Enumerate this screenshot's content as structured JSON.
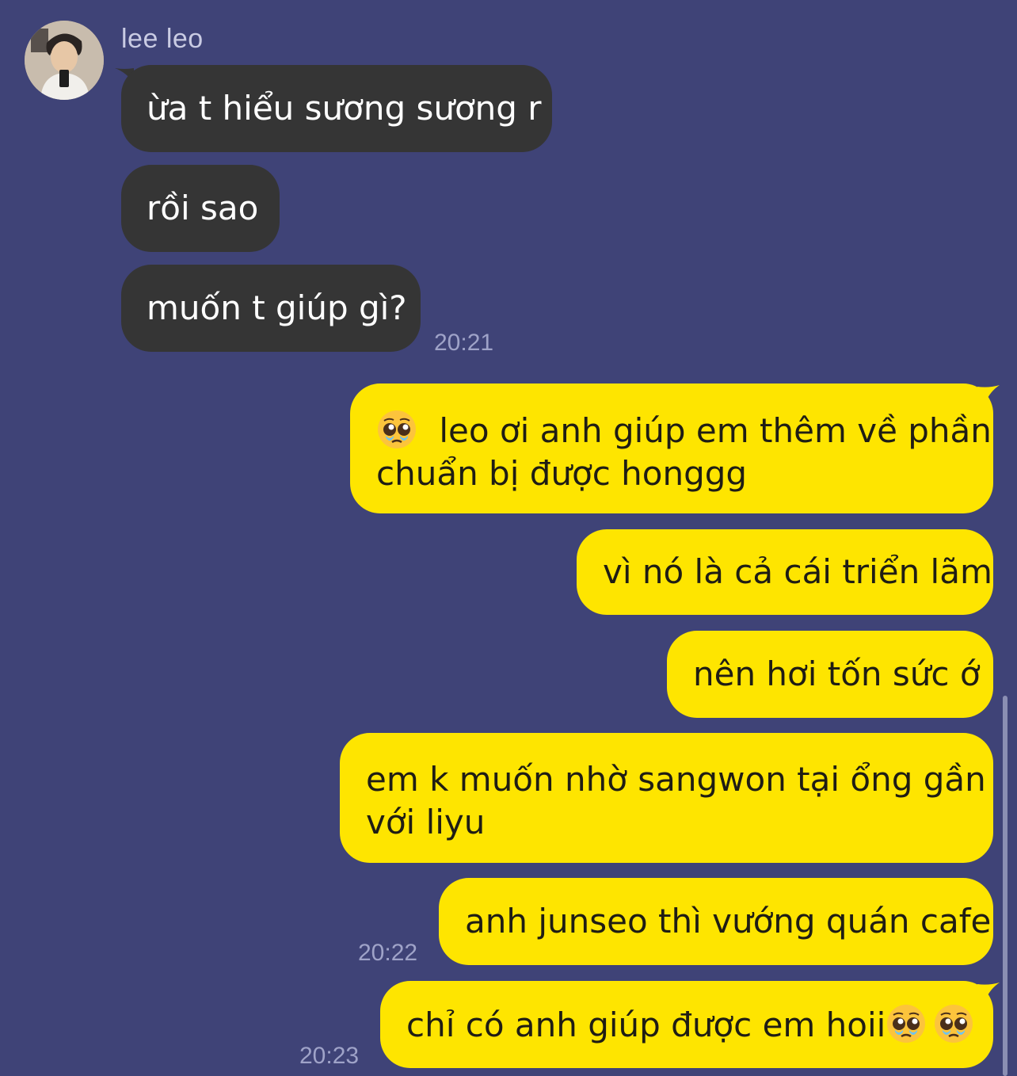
{
  "sender": {
    "name": "lee leo"
  },
  "incoming": [
    {
      "text": "ừa t hiểu sương sương r"
    },
    {
      "text": "rồi sao"
    },
    {
      "text": "muốn t giúp gì?"
    }
  ],
  "incoming_time": "20:21",
  "outgoing": [
    {
      "line1": "leo ơi anh giúp em thêm về phần",
      "line2": "chuẩn bị được honggg",
      "leading_emoji": "pleading-face-emoji"
    },
    {
      "text": "vì nó là cả cái triển lãm"
    },
    {
      "text": "nên hơi tốn sức ớ"
    },
    {
      "line1": "em k muốn nhờ sangwon tại ổng gần",
      "line2": "với liyu"
    },
    {
      "text": "anh junseo thì vướng quán cafe"
    },
    {
      "text": "chỉ có anh giúp được em hoii",
      "trailing_emoji": [
        "pleading-face-emoji",
        "pleading-face-emoji"
      ]
    }
  ],
  "outgoing_times": {
    "t1": "20:22",
    "t2": "20:23"
  },
  "colors": {
    "background": "#3f4377",
    "incoming_bubble": "#353535",
    "outgoing_bubble": "#fee500",
    "timestamp": "#9fa3c8"
  }
}
